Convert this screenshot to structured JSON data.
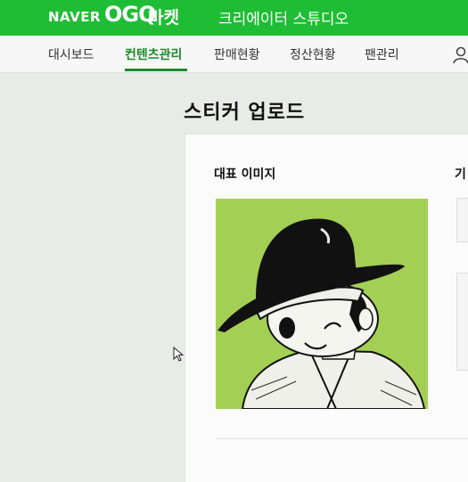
{
  "header": {
    "brand_naver": "NAVER",
    "brand_ogq": "OGQ",
    "brand_market": "마켓",
    "studio_title": "크리에이터 스튜디오",
    "bg_color": "#1fbd35"
  },
  "nav": {
    "items": [
      {
        "label": "대시보드"
      },
      {
        "label": "컨텐츠관리",
        "active": true
      },
      {
        "label": "판매현황"
      },
      {
        "label": "정산현황"
      },
      {
        "label": "팬관리"
      }
    ],
    "accent_color": "#1a8a2a",
    "user_icon": "user-icon"
  },
  "page": {
    "title": "스티커 업로드"
  },
  "form": {
    "main_image_label": "대표 이미지",
    "second_label_partial": "기"
  }
}
